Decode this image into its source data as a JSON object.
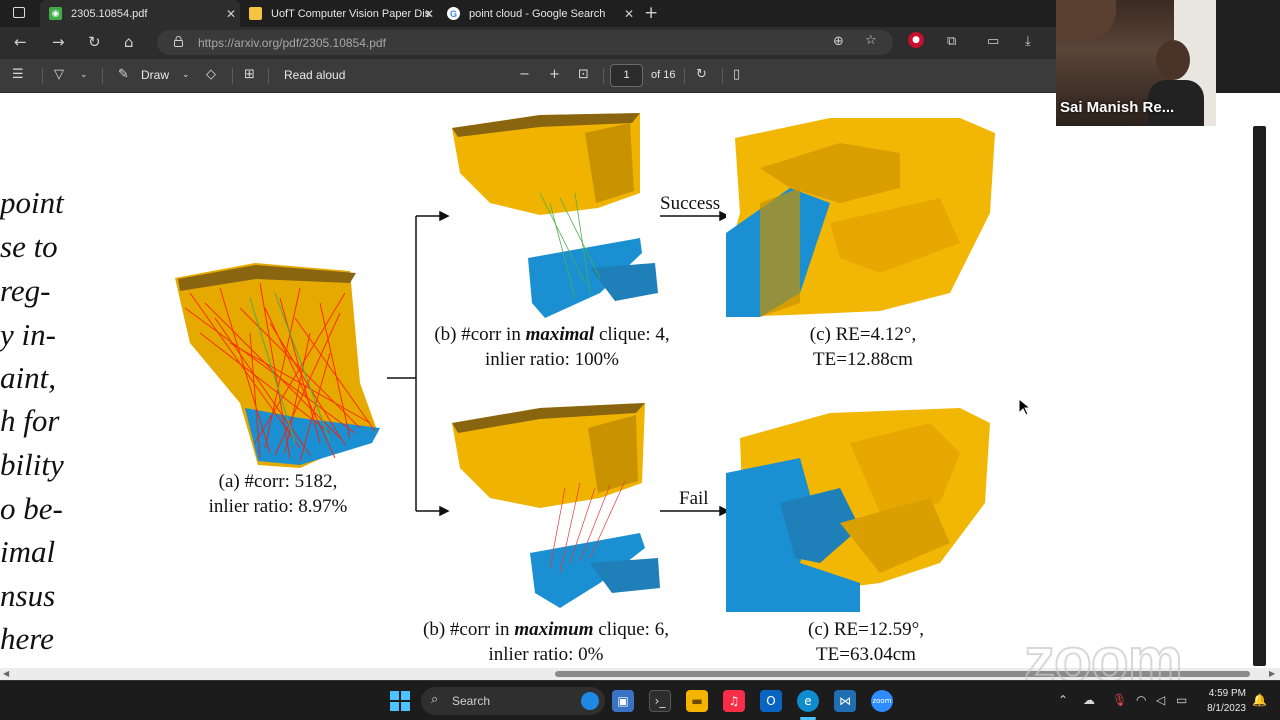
{
  "browser": {
    "tabs": [
      {
        "title": "2305.10854.pdf",
        "close": "✕"
      },
      {
        "title": "UofT Computer Vision Paper Dis",
        "close": "✕"
      },
      {
        "title": "point cloud - Google Search",
        "close": "✕"
      }
    ],
    "new_tab": "+",
    "url": "https://arxiv.org/pdf/2305.10854.pdf"
  },
  "pdf_toolbar": {
    "draw_label": "Draw",
    "read_aloud_label": "Read aloud",
    "page_current": "1",
    "page_total": "of 16"
  },
  "paper": {
    "left_column_fragments": [
      "point",
      "se to",
      "reg-",
      "y in-",
      "aint,",
      "h for",
      "bility",
      "o be-",
      "imal",
      "nsus",
      "here"
    ],
    "figure": {
      "caption_a": [
        "(a) #corr: 5182,",
        "inlier ratio: 8.97%"
      ],
      "caption_b_top": {
        "prefix": "(b) #corr in ",
        "emph": "maximal",
        "suffix": " clique: 4,",
        "line2": "inlier ratio: 100%"
      },
      "caption_c_top": [
        "(c) RE=4.12°,",
        "TE=12.88cm"
      ],
      "caption_b_bottom": {
        "prefix": "(b) #corr in ",
        "emph": "maximum",
        "suffix": " clique: 6,",
        "line2": "inlier ratio: 0%"
      },
      "caption_c_bottom": [
        "(c) RE=12.59°,",
        "TE=63.04cm"
      ],
      "success_label": "Success",
      "fail_label": "Fail"
    },
    "colors": {
      "source_cloud": "#f2b705",
      "target_cloud": "#1a8fd1",
      "outlier_lines": "#ff1a00",
      "inlier_lines": "#4caf50"
    }
  },
  "video_tile": {
    "participant_name": "Sai Manish Re..."
  },
  "watermark": "zoom",
  "taskbar": {
    "search_label": "Search",
    "time": "4:59 PM",
    "date": "8/1/2023"
  }
}
